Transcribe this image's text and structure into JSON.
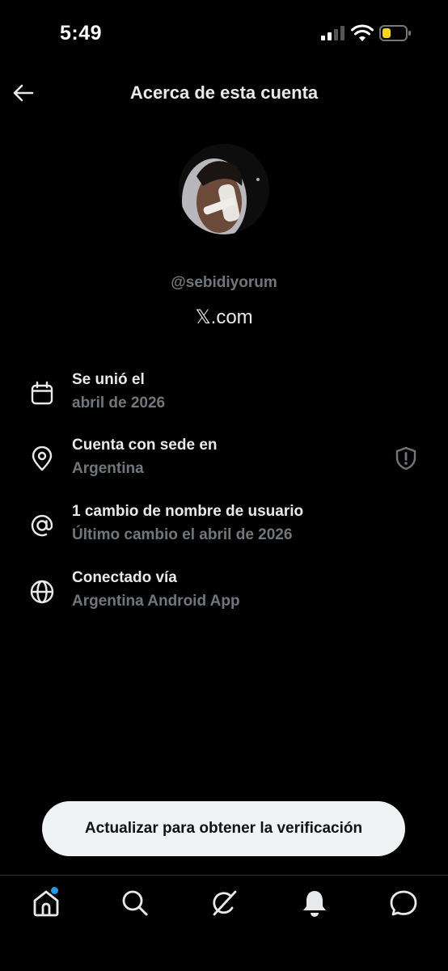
{
  "status": {
    "time": "5:49"
  },
  "header": {
    "title": "Acerca de esta cuenta"
  },
  "profile": {
    "handle": "@sebidiyorum",
    "site": "𝕏.com"
  },
  "rows": [
    {
      "label": "Se unió el",
      "value": "abril de 2026",
      "icon": "calendar-icon"
    },
    {
      "label": "Cuenta con sede en",
      "value": "Argentina",
      "icon": "location-pin-icon"
    },
    {
      "label": "1 cambio de nombre de usuario",
      "value": "Último cambio el abril de 2026",
      "icon": "at-sign-icon"
    },
    {
      "label": "Conectado vía",
      "value": "Argentina Android App",
      "icon": "globe-icon"
    }
  ],
  "cta": {
    "label": "Actualizar para obtener la verificación"
  },
  "tabs": [
    "home-icon",
    "search-icon",
    "grok-icon",
    "notifications-icon",
    "messages-icon"
  ],
  "colors": {
    "background": "#000000",
    "primary_text": "#e7e9ea",
    "secondary_text": "#71767b",
    "accent": "#1d9bf0",
    "battery": "#ffd60a"
  }
}
